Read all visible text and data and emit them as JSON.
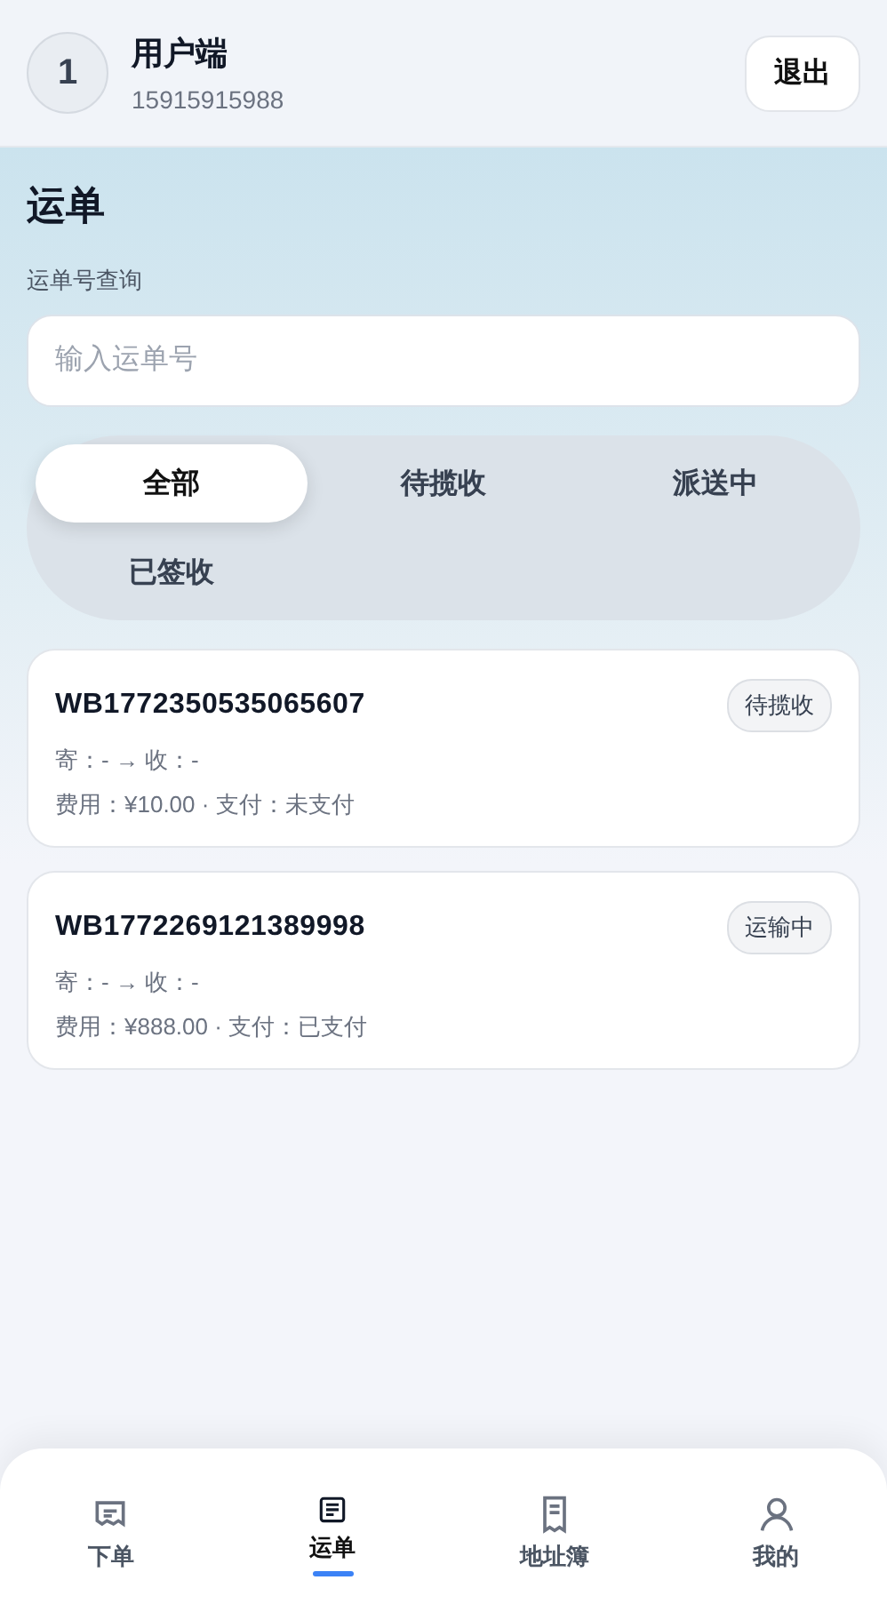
{
  "header": {
    "avatar": "1",
    "name": "用户端",
    "phone": "15915915988",
    "logout": "退出"
  },
  "page": {
    "title": "运单",
    "search_label": "运单号查询",
    "search": {
      "placeholder": "输入运单号"
    }
  },
  "filters": [
    {
      "label": "全部",
      "selected": true
    },
    {
      "label": "待揽收",
      "selected": false
    },
    {
      "label": "派送中",
      "selected": false
    },
    {
      "label": "已签收",
      "selected": false
    }
  ],
  "orders": [
    {
      "number": "WB1772350535065607",
      "status": "待揽收",
      "route": "寄：- → 收：-",
      "fee": "费用：¥10.00 · 支付：未支付"
    },
    {
      "number": "WB1772269121389998",
      "status": "运输中",
      "route": "寄：- → 收：-",
      "fee": "费用：¥888.00 · 支付：已支付"
    }
  ],
  "nav": [
    {
      "kind": "order",
      "label": "下单",
      "selected": false
    },
    {
      "kind": "waybill",
      "label": "运单",
      "selected": true
    },
    {
      "kind": "address",
      "label": "地址簿",
      "selected": false
    },
    {
      "kind": "profile",
      "label": "我的",
      "selected": false
    }
  ]
}
